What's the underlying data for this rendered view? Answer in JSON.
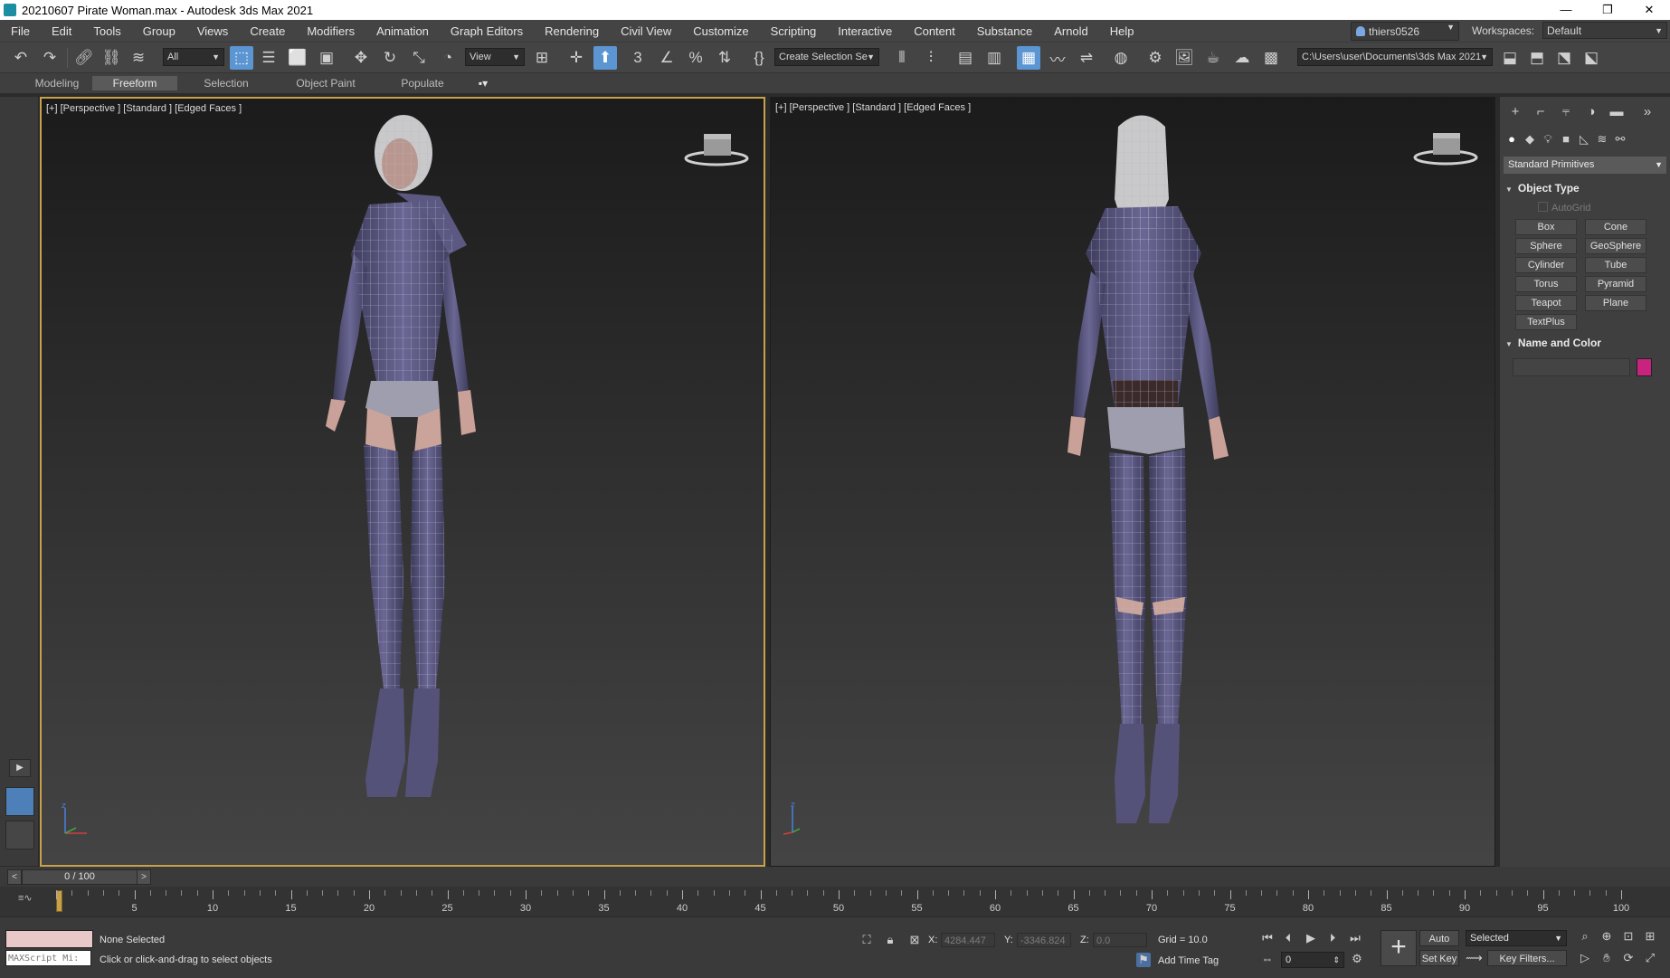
{
  "window": {
    "title": "20210607 Pirate Woman.max - Autodesk 3ds Max 2021",
    "minimize": "—",
    "maximize": "❐",
    "close": "✕"
  },
  "menu": {
    "items": [
      "File",
      "Edit",
      "Tools",
      "Group",
      "Views",
      "Create",
      "Modifiers",
      "Animation",
      "Graph Editors",
      "Rendering",
      "Civil View",
      "Customize",
      "Scripting",
      "Interactive",
      "Content",
      "Substance",
      "Arnold",
      "Help"
    ],
    "user": "thiers0526",
    "workspaces_label": "Workspaces:",
    "workspace": "Default"
  },
  "toolbar": {
    "selection_filter": "All",
    "ref_coord": "View",
    "selection_set": "Create Selection Se",
    "project_path": "C:\\Users\\user\\Documents\\3ds Max 2021"
  },
  "ribbon": {
    "tabs": [
      "Modeling",
      "Freeform",
      "Selection",
      "Object Paint",
      "Populate"
    ],
    "active_tab": "Freeform"
  },
  "viewports": {
    "left_label": "[+] [Perspective ] [Standard ] [Edged Faces ]",
    "right_label": "[+] [Perspective ] [Standard ] [Edged Faces ]"
  },
  "command_panel": {
    "category": "Standard Primitives",
    "object_type_title": "Object Type",
    "autogrid": "AutoGrid",
    "buttons": [
      "Box",
      "Cone",
      "Sphere",
      "GeoSphere",
      "Cylinder",
      "Tube",
      "Torus",
      "Pyramid",
      "Teapot",
      "Plane",
      "TextPlus"
    ],
    "name_color_title": "Name and Color",
    "object_color": "#c8237e"
  },
  "time_slider": {
    "frame_display": "0 / 100",
    "prev": "<",
    "next": ">"
  },
  "trackbar": {
    "labels": [
      "5",
      "10",
      "15",
      "20",
      "25",
      "30",
      "35",
      "40",
      "45",
      "50",
      "55",
      "60",
      "65",
      "70",
      "75",
      "80",
      "85",
      "90",
      "95",
      "100"
    ]
  },
  "status": {
    "maxscript": "MAXScript Mi:",
    "selection": "None Selected",
    "prompt": "Click or click-and-drag to select objects",
    "x_label": "X:",
    "x_value": "4284.447",
    "y_label": "Y:",
    "y_value": "-3346.824",
    "z_label": "Z:",
    "z_value": "0.0",
    "grid": "Grid = 10.0",
    "add_time_tag": "Add Time Tag",
    "auto_key": "Auto Key",
    "set_key": "Set Key",
    "key_mode": "Selected",
    "key_filters": "Key Filters...",
    "current_frame": "0"
  },
  "colors": {
    "accent": "#5b95d2",
    "active_viewport_border": "#c8a24a",
    "suit": "#565378",
    "skin": "#caa49a"
  }
}
